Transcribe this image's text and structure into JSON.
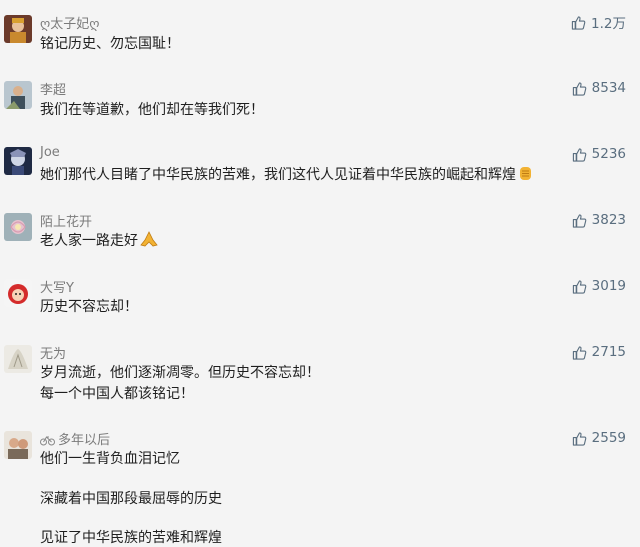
{
  "comments": [
    {
      "user": "ღ太子妃ღ",
      "likes": "1.2万",
      "lines": [
        "铭记历史、勿忘国耻！"
      ]
    },
    {
      "user": "李超",
      "likes": "8534",
      "lines": [
        "我们在等道歉，他们却在等我们死！"
      ]
    },
    {
      "user": "Joe",
      "likes": "5236",
      "lines": [
        "她们那代人目睹了中华民族的苦难，我们这代人见证着中华民族的崛起和辉煌"
      ]
    },
    {
      "user": "陌上花开",
      "likes": "3823",
      "lines": [
        "老人家一路走好"
      ]
    },
    {
      "user": "大写Y",
      "likes": "3019",
      "lines": [
        "历史不容忘却！"
      ]
    },
    {
      "user": "无为",
      "likes": "2715",
      "lines": [
        "岁月流逝，他们逐渐凋零。但历史不容忘却！",
        "每一个中国人都该铭记！"
      ]
    },
    {
      "user": "多年以后",
      "likes": "2559",
      "lines": [
        "他们一生背负血泪记忆",
        "深藏着中国那段最屈辱的历史",
        "见证了中华民族的苦难和辉煌"
      ]
    }
  ],
  "colors": {
    "like": "#5a6e7f",
    "username": "#7b7b7b",
    "text": "#1f1f1f"
  },
  "icons": {
    "like": "thumbs-up-icon",
    "emoji_fist": "raised-fist-emoji",
    "emoji_pray": "folded-hands-emoji",
    "name_prefix": "bicycle-icon"
  }
}
